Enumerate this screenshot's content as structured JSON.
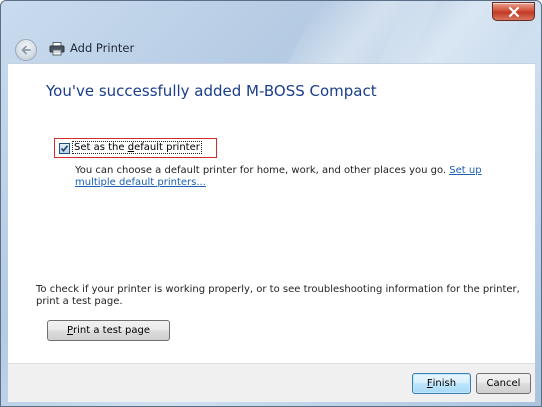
{
  "window": {
    "title": "Add Printer",
    "close_icon": "close-icon",
    "back_icon": "back-arrow-icon",
    "printer_icon": "printer-icon"
  },
  "main": {
    "heading": "You've successfully added M-BOSS Compact",
    "default_checkbox": {
      "label_pre": "Set as the ",
      "label_accel": "d",
      "label_post": "efault printer",
      "checked": true
    },
    "description_text": "You can choose a default printer for home, work, and other places you go. ",
    "description_link": "Set up multiple default printers...",
    "test_info": "To check if your printer is working properly, or to see troubleshooting information for the printer, print a test page.",
    "test_button": {
      "accel": "P",
      "rest": "rint a test page"
    }
  },
  "footer": {
    "finish_accel": "F",
    "finish_rest": "inish",
    "cancel_label": "Cancel"
  },
  "colors": {
    "heading": "#1a3e8a",
    "link": "#1a5fb4",
    "highlight_border": "#d22b2b",
    "close_button": "#c23a24"
  }
}
